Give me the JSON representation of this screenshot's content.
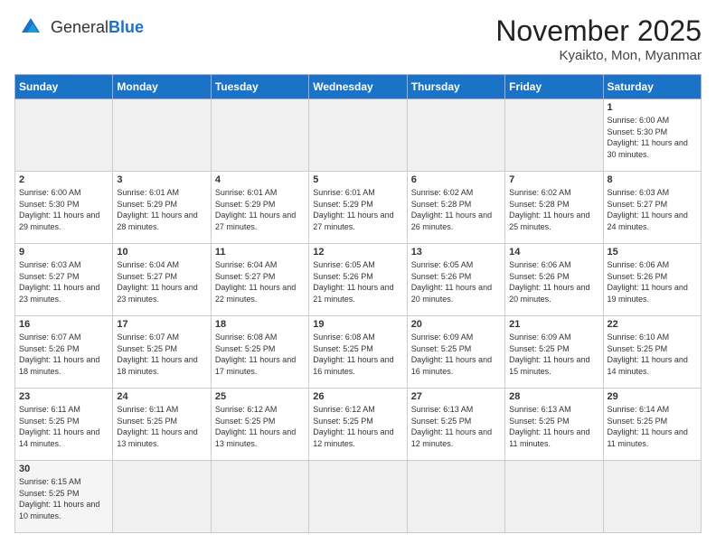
{
  "header": {
    "logo_general": "General",
    "logo_blue": "Blue",
    "month_title": "November 2025",
    "location": "Kyaikto, Mon, Myanmar"
  },
  "weekdays": [
    "Sunday",
    "Monday",
    "Tuesday",
    "Wednesday",
    "Thursday",
    "Friday",
    "Saturday"
  ],
  "weeks": [
    [
      {
        "day": "",
        "info": ""
      },
      {
        "day": "",
        "info": ""
      },
      {
        "day": "",
        "info": ""
      },
      {
        "day": "",
        "info": ""
      },
      {
        "day": "",
        "info": ""
      },
      {
        "day": "",
        "info": ""
      },
      {
        "day": "1",
        "info": "Sunrise: 6:00 AM\nSunset: 5:30 PM\nDaylight: 11 hours and 30 minutes."
      }
    ],
    [
      {
        "day": "2",
        "info": "Sunrise: 6:00 AM\nSunset: 5:30 PM\nDaylight: 11 hours and 29 minutes."
      },
      {
        "day": "3",
        "info": "Sunrise: 6:01 AM\nSunset: 5:29 PM\nDaylight: 11 hours and 28 minutes."
      },
      {
        "day": "4",
        "info": "Sunrise: 6:01 AM\nSunset: 5:29 PM\nDaylight: 11 hours and 27 minutes."
      },
      {
        "day": "5",
        "info": "Sunrise: 6:01 AM\nSunset: 5:29 PM\nDaylight: 11 hours and 27 minutes."
      },
      {
        "day": "6",
        "info": "Sunrise: 6:02 AM\nSunset: 5:28 PM\nDaylight: 11 hours and 26 minutes."
      },
      {
        "day": "7",
        "info": "Sunrise: 6:02 AM\nSunset: 5:28 PM\nDaylight: 11 hours and 25 minutes."
      },
      {
        "day": "8",
        "info": "Sunrise: 6:03 AM\nSunset: 5:27 PM\nDaylight: 11 hours and 24 minutes."
      }
    ],
    [
      {
        "day": "9",
        "info": "Sunrise: 6:03 AM\nSunset: 5:27 PM\nDaylight: 11 hours and 23 minutes."
      },
      {
        "day": "10",
        "info": "Sunrise: 6:04 AM\nSunset: 5:27 PM\nDaylight: 11 hours and 23 minutes."
      },
      {
        "day": "11",
        "info": "Sunrise: 6:04 AM\nSunset: 5:27 PM\nDaylight: 11 hours and 22 minutes."
      },
      {
        "day": "12",
        "info": "Sunrise: 6:05 AM\nSunset: 5:26 PM\nDaylight: 11 hours and 21 minutes."
      },
      {
        "day": "13",
        "info": "Sunrise: 6:05 AM\nSunset: 5:26 PM\nDaylight: 11 hours and 20 minutes."
      },
      {
        "day": "14",
        "info": "Sunrise: 6:06 AM\nSunset: 5:26 PM\nDaylight: 11 hours and 20 minutes."
      },
      {
        "day": "15",
        "info": "Sunrise: 6:06 AM\nSunset: 5:26 PM\nDaylight: 11 hours and 19 minutes."
      }
    ],
    [
      {
        "day": "16",
        "info": "Sunrise: 6:07 AM\nSunset: 5:26 PM\nDaylight: 11 hours and 18 minutes."
      },
      {
        "day": "17",
        "info": "Sunrise: 6:07 AM\nSunset: 5:25 PM\nDaylight: 11 hours and 18 minutes."
      },
      {
        "day": "18",
        "info": "Sunrise: 6:08 AM\nSunset: 5:25 PM\nDaylight: 11 hours and 17 minutes."
      },
      {
        "day": "19",
        "info": "Sunrise: 6:08 AM\nSunset: 5:25 PM\nDaylight: 11 hours and 16 minutes."
      },
      {
        "day": "20",
        "info": "Sunrise: 6:09 AM\nSunset: 5:25 PM\nDaylight: 11 hours and 16 minutes."
      },
      {
        "day": "21",
        "info": "Sunrise: 6:09 AM\nSunset: 5:25 PM\nDaylight: 11 hours and 15 minutes."
      },
      {
        "day": "22",
        "info": "Sunrise: 6:10 AM\nSunset: 5:25 PM\nDaylight: 11 hours and 14 minutes."
      }
    ],
    [
      {
        "day": "23",
        "info": "Sunrise: 6:11 AM\nSunset: 5:25 PM\nDaylight: 11 hours and 14 minutes."
      },
      {
        "day": "24",
        "info": "Sunrise: 6:11 AM\nSunset: 5:25 PM\nDaylight: 11 hours and 13 minutes."
      },
      {
        "day": "25",
        "info": "Sunrise: 6:12 AM\nSunset: 5:25 PM\nDaylight: 11 hours and 13 minutes."
      },
      {
        "day": "26",
        "info": "Sunrise: 6:12 AM\nSunset: 5:25 PM\nDaylight: 11 hours and 12 minutes."
      },
      {
        "day": "27",
        "info": "Sunrise: 6:13 AM\nSunset: 5:25 PM\nDaylight: 11 hours and 12 minutes."
      },
      {
        "day": "28",
        "info": "Sunrise: 6:13 AM\nSunset: 5:25 PM\nDaylight: 11 hours and 11 minutes."
      },
      {
        "day": "29",
        "info": "Sunrise: 6:14 AM\nSunset: 5:25 PM\nDaylight: 11 hours and 11 minutes."
      }
    ],
    [
      {
        "day": "30",
        "info": "Sunrise: 6:15 AM\nSunset: 5:25 PM\nDaylight: 11 hours and 10 minutes."
      },
      {
        "day": "",
        "info": ""
      },
      {
        "day": "",
        "info": ""
      },
      {
        "day": "",
        "info": ""
      },
      {
        "day": "",
        "info": ""
      },
      {
        "day": "",
        "info": ""
      },
      {
        "day": "",
        "info": ""
      }
    ]
  ]
}
